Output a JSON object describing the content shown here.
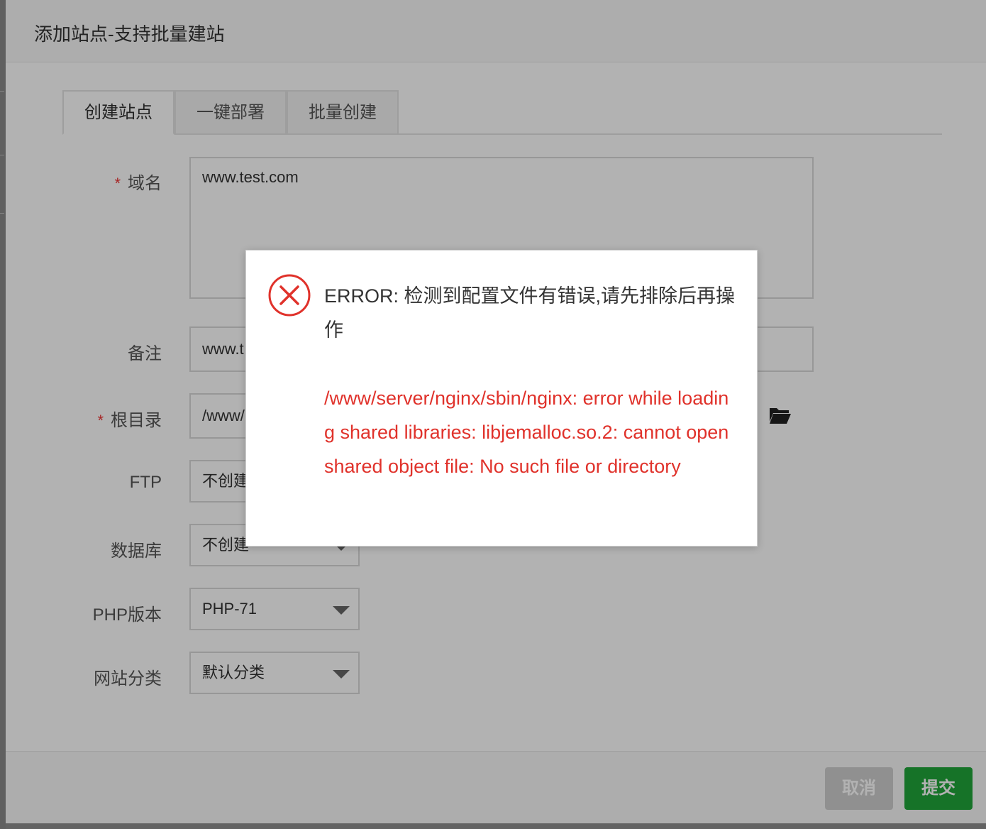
{
  "dialog": {
    "title": "添加站点-支持批量建站",
    "tabs": [
      {
        "label": "创建站点",
        "active": true
      },
      {
        "label": "一键部署",
        "active": false
      },
      {
        "label": "批量创建",
        "active": false
      }
    ]
  },
  "form": {
    "domain": {
      "label": "域名",
      "required": true,
      "value": "www.test.com"
    },
    "remark": {
      "label": "备注",
      "value": "www.t"
    },
    "root": {
      "label": "根目录",
      "required": true,
      "value": "/www/"
    },
    "ftp": {
      "label": "FTP",
      "value": "不创建"
    },
    "database": {
      "label": "数据库",
      "value": "不创建"
    },
    "php": {
      "label": "PHP版本",
      "value": "PHP-71"
    },
    "category": {
      "label": "网站分类",
      "value": "默认分类"
    },
    "required_mark": "*",
    "folder_icon": "folder-open-icon"
  },
  "footer": {
    "cancel_label": "取消",
    "submit_label": "提交"
  },
  "error_modal": {
    "icon": "error-circle-x-icon",
    "message": "ERROR: 检测到配置文件有错误,请先排除后再操作",
    "detail": "/www/server/nginx/sbin/nginx: error while loading shared libraries: libjemalloc.so.2: cannot open shared object file: No such file or directory"
  },
  "colors": {
    "accent_green": "#20a53a",
    "error_red": "#e0322b",
    "required_red": "#ee3333"
  }
}
